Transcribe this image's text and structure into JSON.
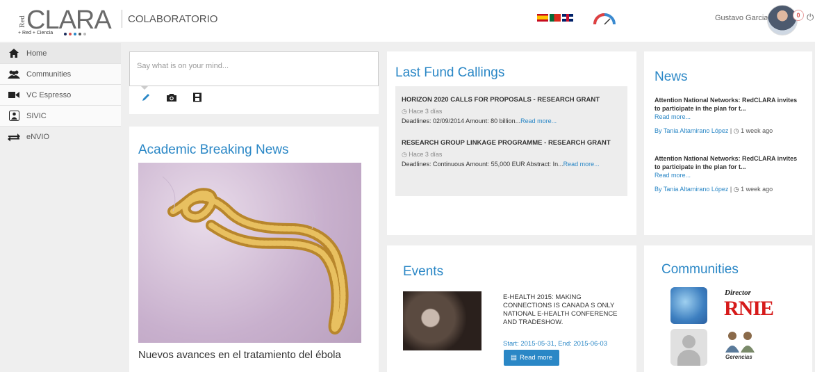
{
  "header": {
    "logo_red": "Red",
    "logo_main": "CLARA",
    "logo_tagline": "+ Red  + Ciencia",
    "app_title": "COLABORATORIO",
    "languages": [
      "es",
      "pt",
      "en"
    ],
    "user_name": "Gustavo Garcia",
    "notification_count": "0"
  },
  "sidebar": {
    "items": [
      {
        "label": "Home",
        "icon": "home-icon"
      },
      {
        "label": "Communities",
        "icon": "users-icon"
      },
      {
        "label": "VC Espresso",
        "icon": "video-camera-icon"
      },
      {
        "label": "SIVIC",
        "icon": "sivic-icon"
      },
      {
        "label": "eNVIO",
        "icon": "transfer-icon"
      }
    ]
  },
  "post": {
    "placeholder": "Say what is on your mind..."
  },
  "academic_news": {
    "title": "Academic Breaking News",
    "caption": "Nuevos avances en el tratamiento del ébola"
  },
  "fund_callings": {
    "title": "Last Fund Callings",
    "items": [
      {
        "title": "HORIZON 2020 CALLS FOR PROPOSALS - RESEARCH GRANT",
        "age": "Hace 3 días",
        "details": "Deadlines: 02/09/2014 Amount: 80 billion...",
        "more": "Read more..."
      },
      {
        "title": "RESEARCH GROUP LINKAGE PROGRAMME - RESEARCH GRANT",
        "age": "Hace 3 días",
        "details": "Deadlines: Continuous Amount: 55,000 EUR Abstract: In...",
        "more": "Read more..."
      }
    ]
  },
  "news": {
    "title": "News",
    "items": [
      {
        "title": "Attention National Networks: RedCLARA invites to participate in the plan for t...",
        "more": "Read more...",
        "author": "By Tania Altamirano López",
        "time": "1 week ago"
      },
      {
        "title": "Attention National Networks: RedCLARA invites to participate in the plan for t...",
        "more": "Read more...",
        "author": "By Tania Altamirano López",
        "time": "1 week ago"
      }
    ]
  },
  "events": {
    "title": "Events",
    "event_text": "E-HEALTH 2015: MAKING CONNECTIONS IS CANADA S ONLY NATIONAL E-HEALTH CONFERENCE AND TRADESHOW.",
    "dates": "Start: 2015-05-31, End: 2015-06-03",
    "button": "Read more"
  },
  "communities": {
    "title": "Communities",
    "thumb_directory_line1": "Director",
    "thumb_directory_line2": "RNIE",
    "thumb_gerencias": "Gerencias"
  },
  "colors": {
    "accent": "#2a87c6",
    "background": "#efefef",
    "badge": "#d9534f"
  }
}
